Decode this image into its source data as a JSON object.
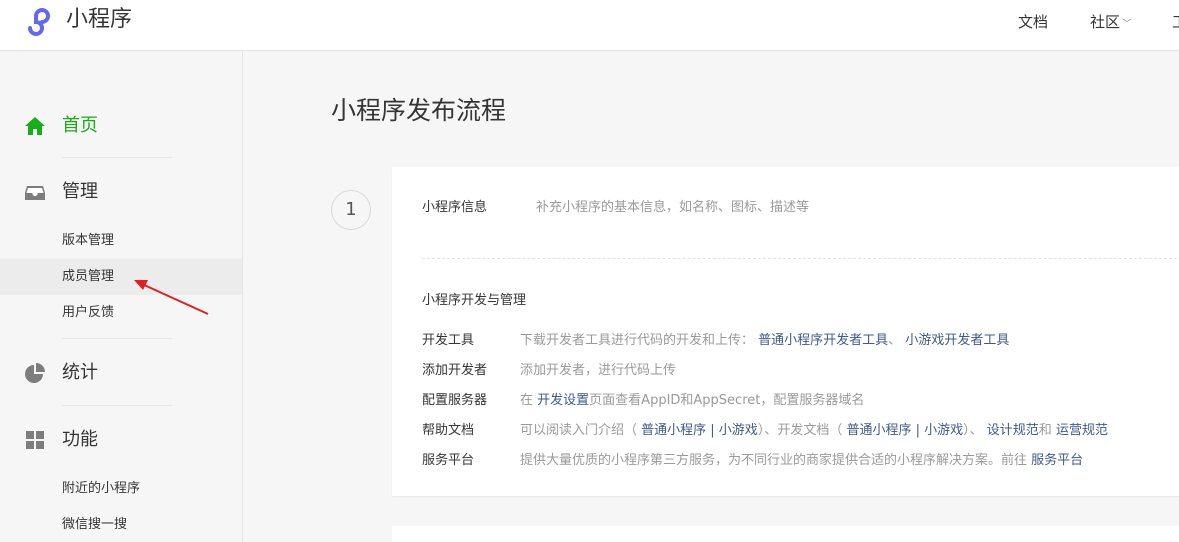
{
  "header": {
    "brand": "小程序",
    "nav": [
      {
        "label": "文档"
      },
      {
        "label": "社区",
        "chevron": "﹀"
      },
      {
        "label": "工"
      }
    ]
  },
  "sidebar": {
    "groups": [
      {
        "label": "首页",
        "icon": "home-icon",
        "active": true
      },
      {
        "label": "管理",
        "icon": "inbox-icon",
        "items": [
          "版本管理",
          "成员管理",
          "用户反馈"
        ],
        "selected": "成员管理"
      },
      {
        "label": "统计",
        "icon": "pie-chart-icon"
      },
      {
        "label": "功能",
        "icon": "grid-icon",
        "items": [
          "附近的小程序",
          "微信搜一搜"
        ]
      }
    ]
  },
  "main": {
    "title": "小程序发布流程",
    "step": "1",
    "info": {
      "label": "小程序信息",
      "desc": "补充小程序的基本信息，如名称、图标、描述等"
    },
    "section_title": "小程序开发与管理",
    "rows": {
      "dev_tools": {
        "label": "开发工具",
        "desc": "下载开发者工具进行代码的开发和上传：",
        "link1": "普通小程序开发者工具",
        "sep": "、",
        "link2": "小游戏开发者工具"
      },
      "add_dev": {
        "label": "添加开发者",
        "desc": "添加开发者，进行代码上传"
      },
      "server": {
        "label": "配置服务器",
        "prefix": "在",
        "link": "开发设置",
        "desc": "页面查看AppID和AppSecret，配置服务器域名"
      },
      "help": {
        "label": "帮助文档",
        "desc1": "可以阅读入门介绍（",
        "link1": "普通小程序 | 小游戏",
        "desc2": "）、开发文档（",
        "link2": "普通小程序 | 小游戏",
        "desc3": "）、",
        "link3": "设计规范",
        "desc4": "和",
        "link4": "运营规范"
      },
      "service": {
        "label": "服务平台",
        "desc": "提供大量优质的小程序第三方服务，为不同行业的商家提供合适的小程序解决方案。前往",
        "link": "服务平台"
      }
    }
  },
  "colors": {
    "accent_green": "#1aad19",
    "link_blue": "#3f5a8a",
    "arrow_red": "#e02020",
    "logo_purple": "#6467f0"
  }
}
